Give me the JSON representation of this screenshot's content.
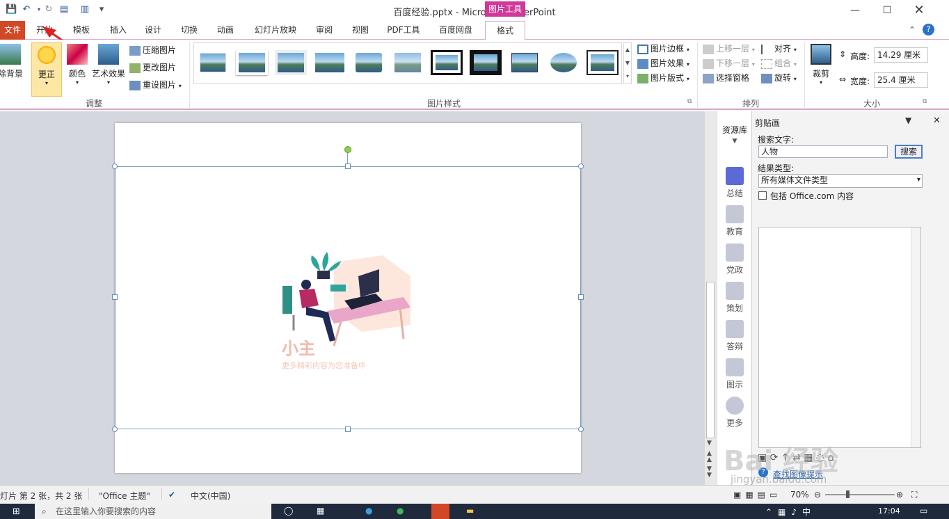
{
  "window": {
    "title": "百度经验.pptx - Microsoft PowerPoint",
    "context_header": "图片工具"
  },
  "tabs": {
    "file": "文件",
    "items": [
      "开始",
      "模板",
      "插入",
      "设计",
      "切换",
      "动画",
      "幻灯片放映",
      "审阅",
      "视图",
      "PDF工具",
      "百度网盘"
    ],
    "active": "格式"
  },
  "ribbon": {
    "adjust": {
      "remove_bg": "除背景",
      "corrections": "更正",
      "color": "颜色",
      "artistic": "艺术效果",
      "compress": "压缩图片",
      "change": "更改图片",
      "reset": "重设图片",
      "label": "调整"
    },
    "styles": {
      "label": "图片样式",
      "border": "图片边框",
      "effects": "图片效果",
      "layout": "图片版式"
    },
    "arrange": {
      "label": "排列",
      "bring_forward": "上移一层",
      "send_backward": "下移一层",
      "selection_pane": "选择窗格",
      "align": "对齐",
      "group": "组合",
      "rotate": "旋转"
    },
    "size": {
      "label": "大小",
      "crop": "裁剪",
      "height_label": "高度:",
      "height_value": "14.29 厘米",
      "width_label": "宽度:",
      "width_value": "25.4 厘米"
    }
  },
  "slide": {
    "picture_caption_big": "小主",
    "picture_caption_small": "更多精彩内容为您准备中"
  },
  "resource_library": {
    "title": "资源库",
    "items": [
      "总结",
      "教育",
      "党政",
      "策划",
      "答辩",
      "图示",
      "更多"
    ]
  },
  "clip_pane": {
    "title": "剪贴画",
    "search_label": "搜索文字:",
    "search_value": "人物",
    "search_button": "搜索",
    "result_type_label": "结果类型:",
    "result_type_value": "所有媒体文件类型",
    "include_office": "包括 Office.com 内容",
    "help_link": "查找图像提示"
  },
  "statusbar": {
    "slide_info": "灯片 第 2 张，共 2 张",
    "theme": "\"Office 主题\"",
    "language": "中文(中国)",
    "zoom": "70%"
  },
  "taskbar": {
    "search_placeholder": "在这里输入你要搜索的内容",
    "time": "17:04"
  },
  "watermark": {
    "site": "jingyan.baidu.com",
    "brand": "Bai 经验"
  },
  "colors": {
    "accent_pink": "#d0389a",
    "file_tab": "#d24726",
    "word_blue": "#2b579a"
  }
}
